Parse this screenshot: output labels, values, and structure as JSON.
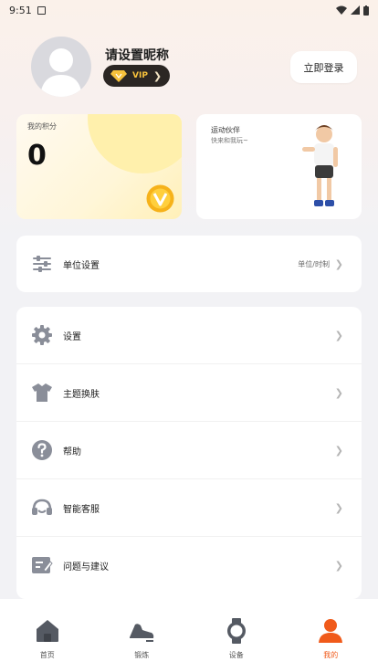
{
  "status": {
    "time": "9:51"
  },
  "profile": {
    "nickname": "请设置昵称",
    "vip_label": "VIP",
    "login_button": "立即登录"
  },
  "points_card": {
    "label": "我的积分",
    "value": "0"
  },
  "buddy_card": {
    "title": "运动伙伴",
    "subtitle": "快来和我玩~"
  },
  "unit_setting": {
    "label": "单位设置",
    "value": "单位/时制"
  },
  "menu": [
    {
      "label": "设置",
      "icon": "gear-icon"
    },
    {
      "label": "主题换肤",
      "icon": "shirt-icon"
    },
    {
      "label": "帮助",
      "icon": "help-icon"
    },
    {
      "label": "智能客服",
      "icon": "headset-icon"
    },
    {
      "label": "问题与建议",
      "icon": "feedback-icon"
    }
  ],
  "tabs": [
    {
      "label": "首页",
      "icon": "home-icon",
      "active": false
    },
    {
      "label": "锻炼",
      "icon": "shoe-icon",
      "active": false
    },
    {
      "label": "设备",
      "icon": "watch-icon",
      "active": false
    },
    {
      "label": "我的",
      "icon": "person-icon",
      "active": true
    }
  ],
  "colors": {
    "accent": "#f05a1a",
    "vip_gold": "#f6c13c",
    "icon_gray": "#8a8e99"
  }
}
